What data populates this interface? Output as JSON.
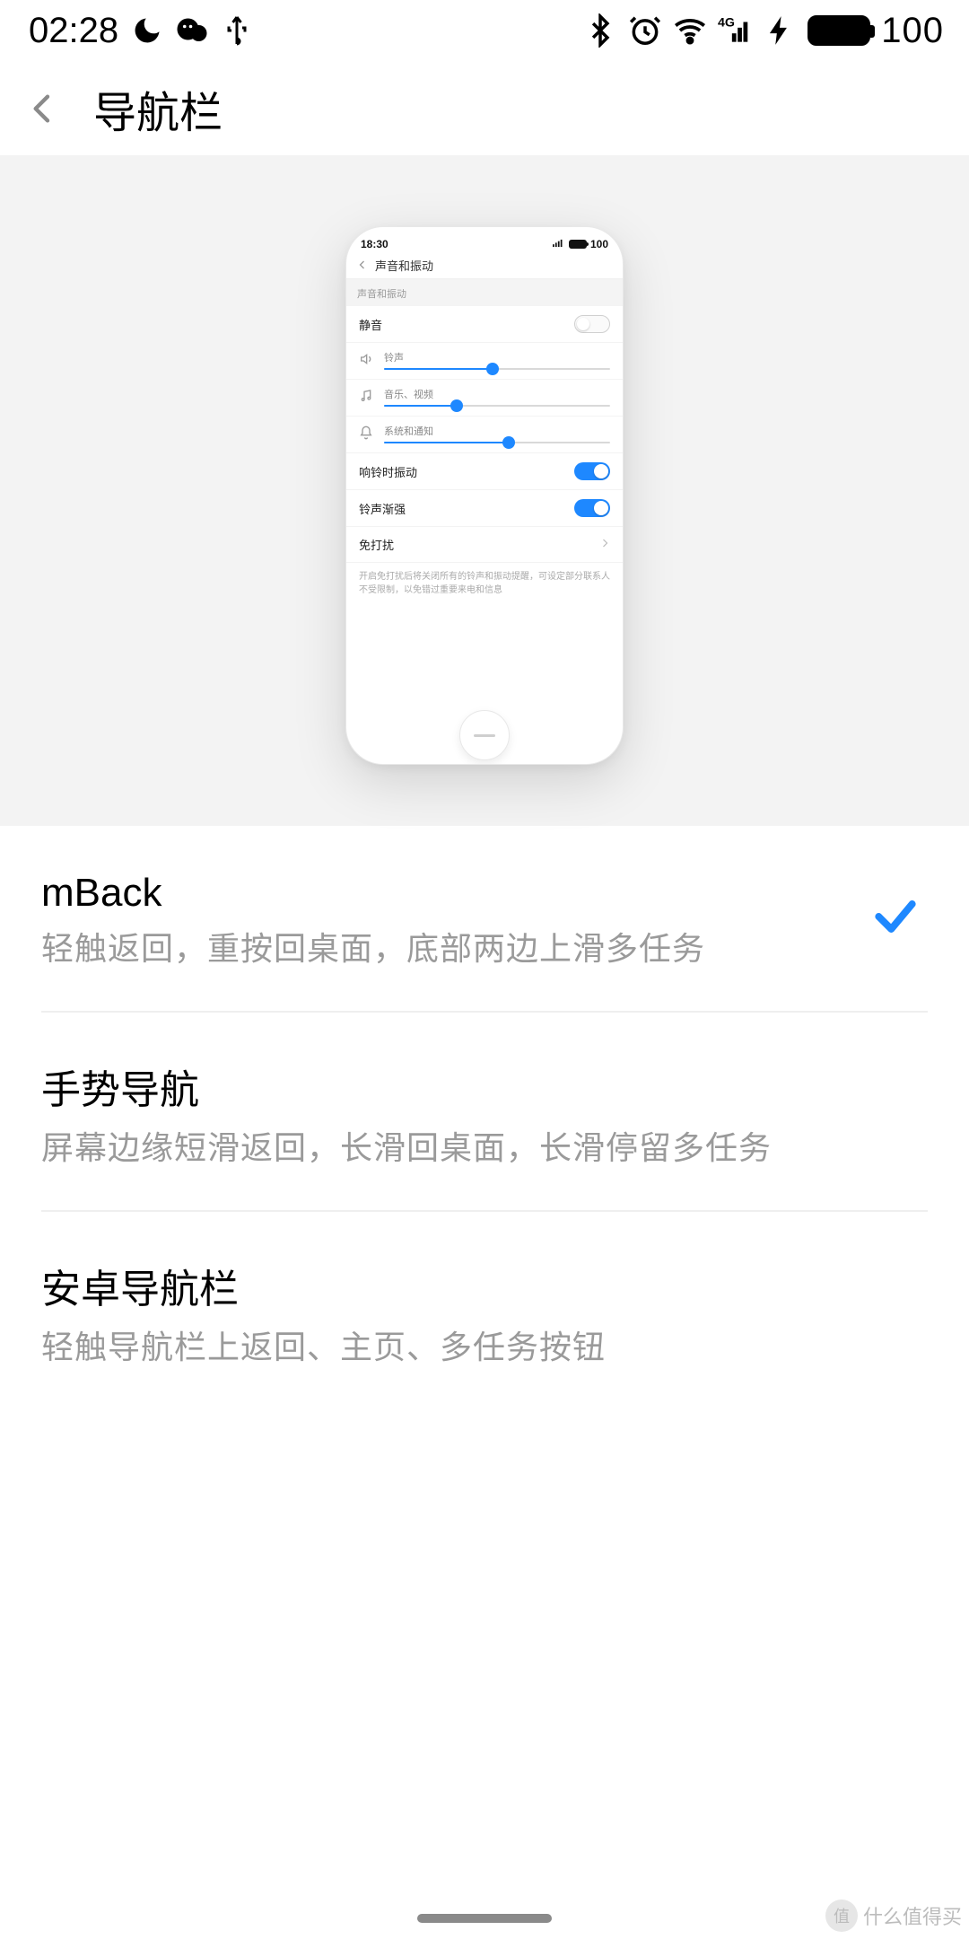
{
  "status": {
    "time": "02:28",
    "battery": "100"
  },
  "header": {
    "title": "导航栏"
  },
  "preview": {
    "status_time": "18:30",
    "status_battery": "100",
    "page_title": "声音和振动",
    "section_label": "声音和振动",
    "mute_label": "静音",
    "mute_on": false,
    "sliders": [
      {
        "icon": "speaker",
        "label": "铃声",
        "value": 48
      },
      {
        "icon": "music",
        "label": "音乐、视频",
        "value": 32
      },
      {
        "icon": "bell",
        "label": "系统和通知",
        "value": 55
      }
    ],
    "vibrate_label": "响铃时振动",
    "vibrate_on": true,
    "fade_label": "铃声渐强",
    "fade_on": true,
    "dnd_label": "免打扰",
    "dnd_note": "开启免打扰后将关闭所有的铃声和振动提醒，可设定部分联系人不受限制，以免错过重要来电和信息"
  },
  "options": [
    {
      "title": "mBack",
      "desc": "轻触返回，重按回桌面，底部两边上滑多任务",
      "selected": true
    },
    {
      "title": "手势导航",
      "desc": "屏幕边缘短滑返回，长滑回桌面，长滑停留多任务",
      "selected": false
    },
    {
      "title": "安卓导航栏",
      "desc": "轻触导航栏上返回、主页、多任务按钮",
      "selected": false
    }
  ],
  "watermark": "什么值得买"
}
